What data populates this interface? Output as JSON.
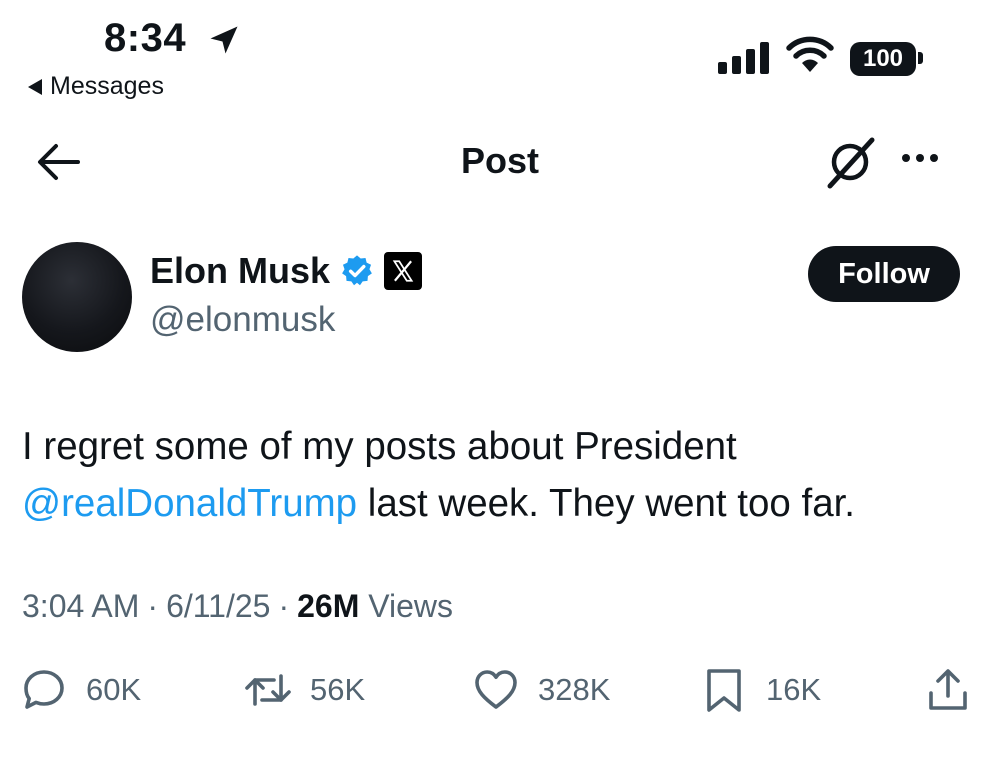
{
  "status_bar": {
    "time": "8:34",
    "back_app": "Messages",
    "battery": "100"
  },
  "nav": {
    "title": "Post"
  },
  "author": {
    "name": "Elon Musk",
    "handle": "@elonmusk",
    "badge_icon": "verified-badge-icon",
    "affiliation_icon": "x-logo-icon"
  },
  "follow_label": "Follow",
  "post": {
    "text_line1": "I regret some of my posts about President",
    "mention": "@realDonaldTrump",
    "text_line2": " last week. They went too far."
  },
  "meta": {
    "time": "3:04 AM",
    "sep1": "·",
    "date": "6/11/25",
    "sep2": "·",
    "views_count": "26M",
    "views_label": "Views"
  },
  "actions": {
    "replies": "60K",
    "reposts": "56K",
    "likes": "328K",
    "bookmarks": "16K"
  },
  "colors": {
    "text": "#0f1419",
    "secondary": "#536471",
    "link": "#1d9bf0",
    "verified": "#1d9bf0"
  }
}
